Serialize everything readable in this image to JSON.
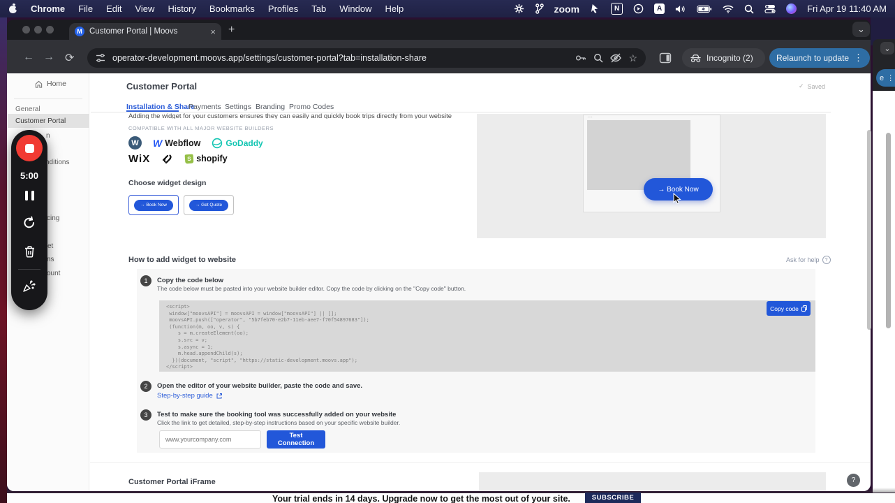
{
  "menubar": {
    "items": [
      "Chrome",
      "File",
      "Edit",
      "View",
      "History",
      "Bookmarks",
      "Profiles",
      "Tab",
      "Window",
      "Help"
    ],
    "zoom_label": "zoom",
    "clock": "Fri Apr 19 11:40 AM"
  },
  "browser": {
    "tab_title": "Customer Portal | Moovs",
    "favicon_letter": "M",
    "url": "operator-development.moovs.app/settings/customer-portal?tab=installation-share",
    "incognito_label": "Incognito (2)",
    "relaunch_label": "Relaunch to update"
  },
  "recorder": {
    "time": "5:00"
  },
  "sidebar": {
    "home_label": "Home",
    "items": [
      {
        "label": "General"
      },
      {
        "label": "Customer Portal"
      }
    ],
    "occluded_fragments": [
      "n",
      "nditions",
      "cing",
      "et",
      "ns",
      "count"
    ]
  },
  "page": {
    "title": "Customer Portal",
    "saved_label": "Saved",
    "tabs": [
      {
        "label": "Installation & Share"
      },
      {
        "label": "Payments"
      },
      {
        "label": "Settings"
      },
      {
        "label": "Branding"
      },
      {
        "label": "Promo Codes"
      }
    ],
    "intro": "Adding the widget for your customers ensures they can easily and quickly book trips directly from your website",
    "compatible_label": "COMPATIBLE WITH ALL MAJOR WEBSITE BUILDERS",
    "builders": {
      "wordpress_letter": "W",
      "webflow": "Webflow",
      "godaddy": "GoDaddy",
      "wix": "WiX",
      "shopify": "shopify",
      "shopify_letter": "S"
    },
    "choose_design": {
      "title": "Choose widget design",
      "book_now": "→ Book Now",
      "get_quote": "→ Get Quote"
    },
    "preview": {
      "button": "→ Book Now"
    },
    "howto": {
      "title": "How to add widget to website",
      "ask_help": "Ask for help",
      "copy_button": "Copy code",
      "steps": [
        {
          "num": "1",
          "title": "Copy the code below",
          "desc": "The code below must be pasted into your website builder editor. Copy the code by clicking on the \"Copy code\" button."
        },
        {
          "num": "2",
          "title": "Open the editor of your website builder, paste the code and save.",
          "link": "Step-by-step guide"
        },
        {
          "num": "3",
          "title": "Test to make sure the booking tool was successfully added on your website",
          "desc": "Click the link to get detailed, step-by-step instructions based on your specific website builder.",
          "input_placeholder": "www.yourcompany.com",
          "button": "Test Connection"
        }
      ],
      "code": "<script>\n window[\"moovsAPI\"] = moovsAPI = window[\"moovsAPI\"] || [];\n moovsAPI.push([\"operator\", \"5b7feb70-e2b7-11eb-aee7-f70f54897683\"]);\n (function(m, oo, v, s) {\n    s = m.createElement(oo);\n    s.src = v;\n    s.async = 1;\n    m.head.appendChild(s);\n  })(document, \"script\", \"https://static-development.moovs.app\");\n</script>"
    },
    "iframe_title": "Customer Portal iFrame"
  },
  "banner": {
    "text": "Your trial ends in 14 days. Upgrade now to get the most out of your site.",
    "button": "SUBSCRIBE"
  },
  "colors": {
    "moovs_blue": "#2257d9",
    "tab_active_blue": "#2f5fd9",
    "relaunch_blue": "#2e6da4",
    "record_red": "#f13b33",
    "banner_navy": "#1d2a5a",
    "godaddy_teal": "#12c5b2",
    "shopify_green": "#95bf47"
  },
  "icons": {
    "check": "✓",
    "chevron_down": "⌄",
    "close": "×",
    "plus": "+",
    "kebab": "⋮",
    "question": "?",
    "back": "←",
    "forward": "→",
    "reload": "⟳",
    "star": "☆",
    "dots": "⋯"
  }
}
